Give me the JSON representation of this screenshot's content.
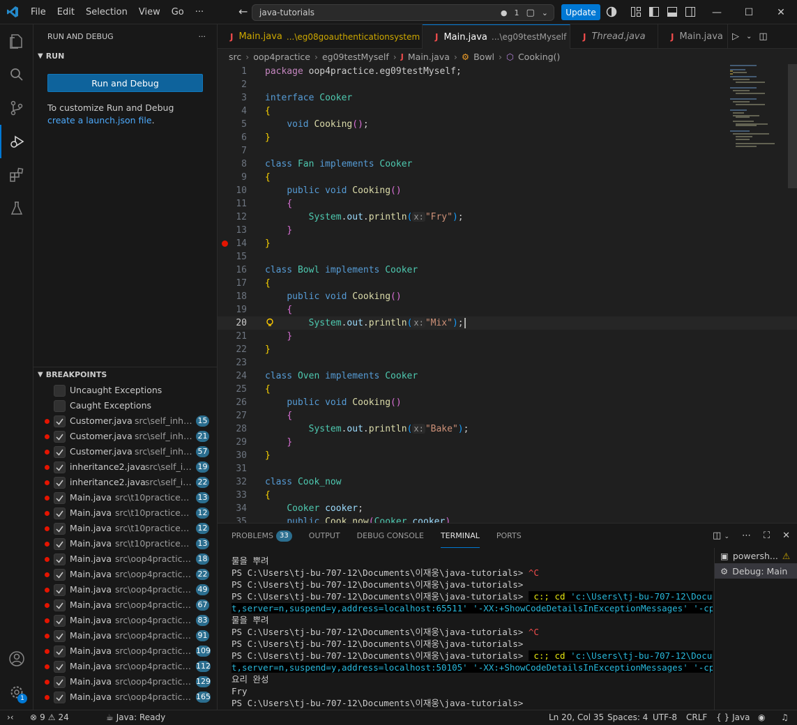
{
  "titlebar": {
    "menu": [
      "File",
      "Edit",
      "Selection",
      "View",
      "Go",
      "···"
    ],
    "search_text": "java-tutorials",
    "notif_count": "1",
    "update_label": "Update"
  },
  "activity": {
    "settings_badge": "1"
  },
  "sidebar": {
    "title": "RUN AND DEBUG",
    "more": "···",
    "run_section": "RUN",
    "run_button": "Run and Debug",
    "help_prefix": "To customize Run and Debug ",
    "help_link": "create a launch.json file",
    "help_suffix": ".",
    "breakpoints_section": "BREAKPOINTS",
    "exceptions": [
      {
        "label": "Uncaught Exceptions"
      },
      {
        "label": "Caught Exceptions"
      }
    ],
    "breakpoints": [
      {
        "file": "Customer.java",
        "path": "src\\self_inhrit...",
        "line": "15"
      },
      {
        "file": "Customer.java",
        "path": "src\\self_inhrit...",
        "line": "21"
      },
      {
        "file": "Customer.java",
        "path": "src\\self_inhrit...",
        "line": "57"
      },
      {
        "file": "inheritance2.java",
        "path": "src\\self_in...",
        "line": "19"
      },
      {
        "file": "inheritance2.java",
        "path": "src\\self_in...",
        "line": "22"
      },
      {
        "file": "Main.java",
        "path": "src\\t10practices\\e...",
        "line": "13"
      },
      {
        "file": "Main.java",
        "path": "src\\t10practices\\e...",
        "line": "12"
      },
      {
        "file": "Main.java",
        "path": "src\\t10practices\\e...",
        "line": "12"
      },
      {
        "file": "Main.java",
        "path": "src\\t10practices\\e...",
        "line": "13"
      },
      {
        "file": "Main.java",
        "path": "src\\oop4practice\\...",
        "line": "18"
      },
      {
        "file": "Main.java",
        "path": "src\\oop4practice\\...",
        "line": "22"
      },
      {
        "file": "Main.java",
        "path": "src\\oop4practice\\...",
        "line": "49"
      },
      {
        "file": "Main.java",
        "path": "src\\oop4practice\\...",
        "line": "67"
      },
      {
        "file": "Main.java",
        "path": "src\\oop4practice\\...",
        "line": "83"
      },
      {
        "file": "Main.java",
        "path": "src\\oop4practice\\...",
        "line": "91"
      },
      {
        "file": "Main.java",
        "path": "src\\oop4practice...",
        "line": "109"
      },
      {
        "file": "Main.java",
        "path": "src\\oop4practice...",
        "line": "112"
      },
      {
        "file": "Main.java",
        "path": "src\\oop4practice...",
        "line": "129"
      },
      {
        "file": "Main.java",
        "path": "src\\oop4practice...",
        "line": "165"
      }
    ]
  },
  "tabs": [
    {
      "name": "Main.java",
      "desc": "...\\eg08goauthenticationsystem",
      "problems": "1",
      "active": false
    },
    {
      "name": "Main.java",
      "desc": "...\\eg09testMyself",
      "close": "✕",
      "active": true
    },
    {
      "name": "Thread.java",
      "desc": "",
      "active": false
    },
    {
      "name": "Main.java",
      "desc": "...",
      "active": false
    }
  ],
  "breadcrumb": [
    "src",
    "oop4practice",
    "eg09testMyself",
    "Main.java",
    "Bowl",
    "Cooking()"
  ],
  "editor": {
    "current_line": 20,
    "lines": [
      {
        "n": "1"
      },
      {
        "n": "2"
      },
      {
        "n": "3"
      },
      {
        "n": "4"
      },
      {
        "n": "5"
      },
      {
        "n": "6"
      },
      {
        "n": "7"
      },
      {
        "n": "8"
      },
      {
        "n": "9"
      },
      {
        "n": "10"
      },
      {
        "n": "11"
      },
      {
        "n": "12"
      },
      {
        "n": "13"
      },
      {
        "n": "14"
      },
      {
        "n": "15"
      },
      {
        "n": "16"
      },
      {
        "n": "17"
      },
      {
        "n": "18"
      },
      {
        "n": "19"
      },
      {
        "n": "20"
      },
      {
        "n": "21"
      },
      {
        "n": "22"
      },
      {
        "n": "23"
      },
      {
        "n": "24"
      },
      {
        "n": "25"
      },
      {
        "n": "26"
      },
      {
        "n": "27"
      },
      {
        "n": "28"
      },
      {
        "n": "29"
      },
      {
        "n": "30"
      },
      {
        "n": "31"
      },
      {
        "n": "32"
      },
      {
        "n": "33"
      },
      {
        "n": "34"
      },
      {
        "n": "35"
      }
    ],
    "code": {
      "l1a": "package",
      "l1b": " oop4practice.eg09testMyself;",
      "interface": "interface",
      "cooker": "Cooker",
      "void": "void",
      "cooking": "Cooking",
      "class": "class",
      "implements": "implements",
      "public": "public",
      "fan": "Fan",
      "bowl": "Bowl",
      "oven": "Oven",
      "cook_now": "Cook_now",
      "system": "System",
      "out": "out",
      "println": "println",
      "hint": "x:",
      "fry": "\"Fry\"",
      "mix": "\"Mix\"",
      "bake": "\"Bake\"",
      "cooker_var": "cooker"
    }
  },
  "panel": {
    "tabs": [
      "PROBLEMS",
      "OUTPUT",
      "DEBUG CONSOLE",
      "TERMINAL",
      "PORTS"
    ],
    "problems_count": "33",
    "terminal_lines": [
      {
        "t": "물을 뿌려",
        "kind": "plain"
      },
      {
        "t": "PS C:\\Users\\tj-bu-707-12\\Documents\\이재웅\\java-tutorials> ",
        "extra": "^C",
        "kind": "ctrlc"
      },
      {
        "t": "PS C:\\Users\\tj-bu-707-12\\Documents\\이재웅\\java-tutorials>",
        "kind": "plain"
      },
      {
        "t": "PS C:\\Users\\tj-bu-707-12\\Documents\\이재웅\\java-tutorials> ",
        "cmd1": " c:; cd ",
        "cmd2": "'c:\\Users\\tj-bu-707-12\\Documen",
        "kind": "cmd"
      },
      {
        "t": "t,server=n,suspend=y,address=localhost:65511' '-XX:+ShowCodeDetailsInExceptionMessages' '-cp' 'C",
        "kind": "cmdcont"
      },
      {
        "t": "물을 뿌려",
        "kind": "plain"
      },
      {
        "t": "PS C:\\Users\\tj-bu-707-12\\Documents\\이재웅\\java-tutorials> ",
        "extra": "^C",
        "kind": "ctrlc"
      },
      {
        "t": "PS C:\\Users\\tj-bu-707-12\\Documents\\이재웅\\java-tutorials>",
        "kind": "plain"
      },
      {
        "t": "PS C:\\Users\\tj-bu-707-12\\Documents\\이재웅\\java-tutorials> ",
        "cmd1": " c:; cd ",
        "cmd2": "'c:\\Users\\tj-bu-707-12\\Documen",
        "kind": "cmd"
      },
      {
        "t": "t,server=n,suspend=y,address=localhost:50105' '-XX:+ShowCodeDetailsInExceptionMessages' '-cp' 'C",
        "kind": "cmdcont"
      },
      {
        "t": "요리 완성",
        "kind": "plain"
      },
      {
        "t": "Fry",
        "kind": "plain"
      },
      {
        "t": "PS C:\\Users\\tj-bu-707-12\\Documents\\이재웅\\java-tutorials>",
        "kind": "plain"
      }
    ],
    "terminal_list": [
      {
        "label": "powersh...",
        "warn": true
      },
      {
        "label": "Debug: Main",
        "active": true
      }
    ]
  },
  "status": {
    "errors": "9",
    "warnings": "24",
    "java": "Java: Ready",
    "position": "Ln 20, Col 35",
    "spaces": "Spaces: 4",
    "encoding": "UTF-8",
    "eol": "CRLF",
    "language": "Java"
  }
}
